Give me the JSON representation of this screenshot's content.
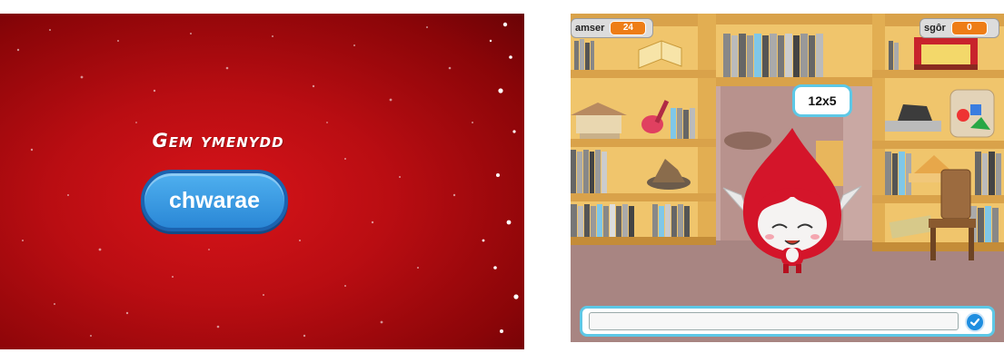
{
  "title_screen": {
    "title": "Gem ymenydd",
    "play_button": "chwarae"
  },
  "game": {
    "timer_label": "amser",
    "timer_value": "24",
    "score_label": "sgôr",
    "score_value": "0",
    "question": "12x5",
    "answer_value": ""
  },
  "colors": {
    "title_bg": "#b90d12",
    "button_blue": "#2a87d6",
    "readout_orange": "#ee7d16",
    "accent_cyan": "#5dc8e6",
    "shelf_wood": "#e8b65c",
    "character_red": "#d4152a"
  },
  "icons": {
    "submit": "checkmark-icon"
  }
}
